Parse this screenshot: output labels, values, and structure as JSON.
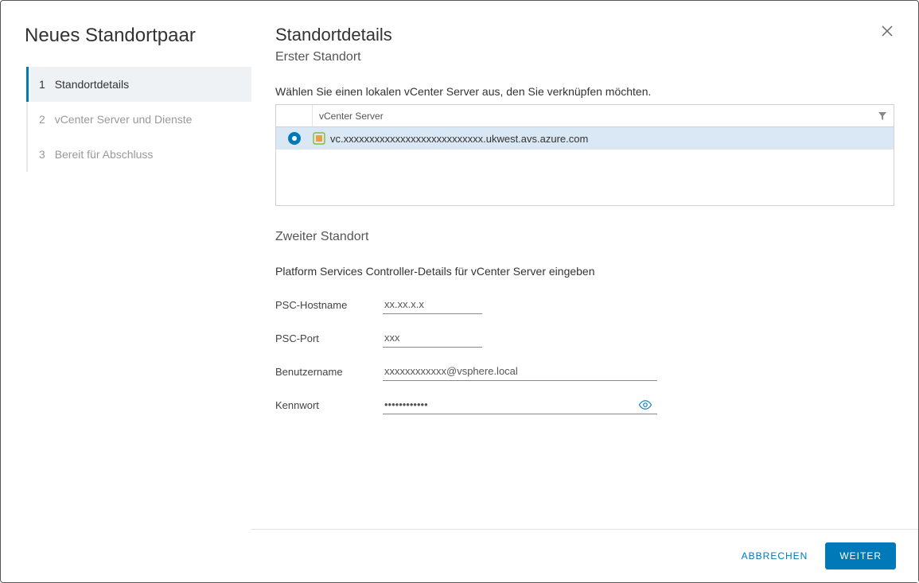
{
  "sidebar": {
    "title": "Neues Standortpaar",
    "steps": [
      {
        "num": "1",
        "label": "Standortdetails",
        "active": true
      },
      {
        "num": "2",
        "label": "vCenter Server und Dienste",
        "active": false
      },
      {
        "num": "3",
        "label": "Bereit für Abschluss",
        "active": false
      }
    ]
  },
  "main": {
    "title": "Standortdetails",
    "section1_subtitle": "Erster Standort",
    "section1_instruction": "Wählen Sie einen lokalen vCenter Server aus, den Sie verknüpfen möchten.",
    "table": {
      "header": "vCenter Server",
      "row_value": "vc.xxxxxxxxxxxxxxxxxxxxxxxxxxx.ukwest.avs.azure.com"
    },
    "section2_subtitle": "Zweiter Standort",
    "section2_instruction": "Platform Services Controller-Details für vCenter Server eingeben",
    "form": {
      "psc_host_label": "PSC-Hostname",
      "psc_host_value": "xx.xx.x.x",
      "psc_port_label": "PSC-Port",
      "psc_port_value": "xxx",
      "username_label": "Benutzername",
      "username_value": "xxxxxxxxxxxx@vsphere.local",
      "password_label": "Kennwort",
      "password_value": "••••••••••••"
    }
  },
  "footer": {
    "cancel": "ABBRECHEN",
    "next": "WEITER"
  }
}
